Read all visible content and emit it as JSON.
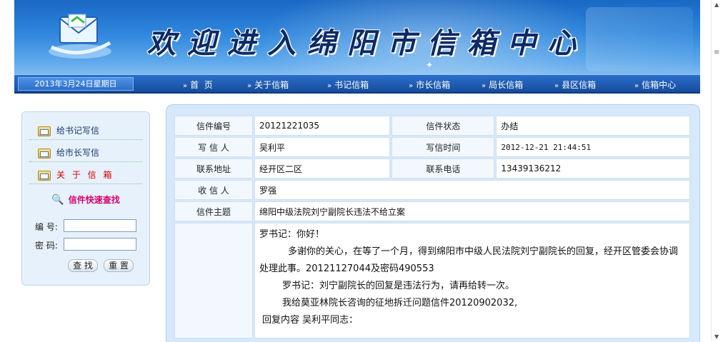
{
  "banner": {
    "title": "欢迎进入绵阳市信箱中心"
  },
  "nav": {
    "date": "2013年3月24日星期日",
    "items": [
      "首  页",
      "关于信箱",
      "书记信箱",
      "市长信箱",
      "局长信箱",
      "县区信箱",
      "信箱中心"
    ],
    "arrow": "»"
  },
  "sidebar": {
    "items": [
      "给书记写信",
      "给市长写信",
      "关 于 信 箱"
    ],
    "quick_search_title": "信件快速查找",
    "number_label": "编 号:",
    "password_label": "密 码:",
    "number_value": "",
    "password_value": "",
    "search_button": "查 找",
    "reset_button": "重 置"
  },
  "letter": {
    "number_label": "信件编号",
    "number": "20121221035",
    "status_label": "信件状态",
    "status": "办结",
    "writer_label": "写 信 人",
    "writer": "吴利平",
    "time_label": "写信时间",
    "time": "2012-12-21 21:44:51",
    "address_label": "联系地址",
    "address": "经开区二区",
    "phone_label": "联系电话",
    "phone": "13439136212",
    "recipient_label": "收 信 人",
    "recipient": "罗强",
    "subject_label": "信件主题",
    "subject": "绵阳中级法院刘宁副院长违法不给立案",
    "content": [
      "罗书记：你好！",
      "多谢你的关心，在等了一个月，得到绵阳市中级人民法院刘宁副院长的回复，经开区管委会协调",
      "处理此事。20121127044及密码490553",
      "罗书记：刘宁副院长的回复是违法行为，请再给转一次。",
      "我给莫亚林院长咨询的征地拆迁问题信件20120902032,",
      "回复内容 吴利平同志："
    ]
  },
  "colors": {
    "banner_top": "#1868c4",
    "nav": "#174c9c",
    "panel": "#d6e9fb",
    "active_side": "#d40000",
    "quick_search": "#d4006e"
  },
  "icons": [
    "letter-logo-icon",
    "folder-icon",
    "key-icon",
    "chevron-double-right-icon"
  ]
}
